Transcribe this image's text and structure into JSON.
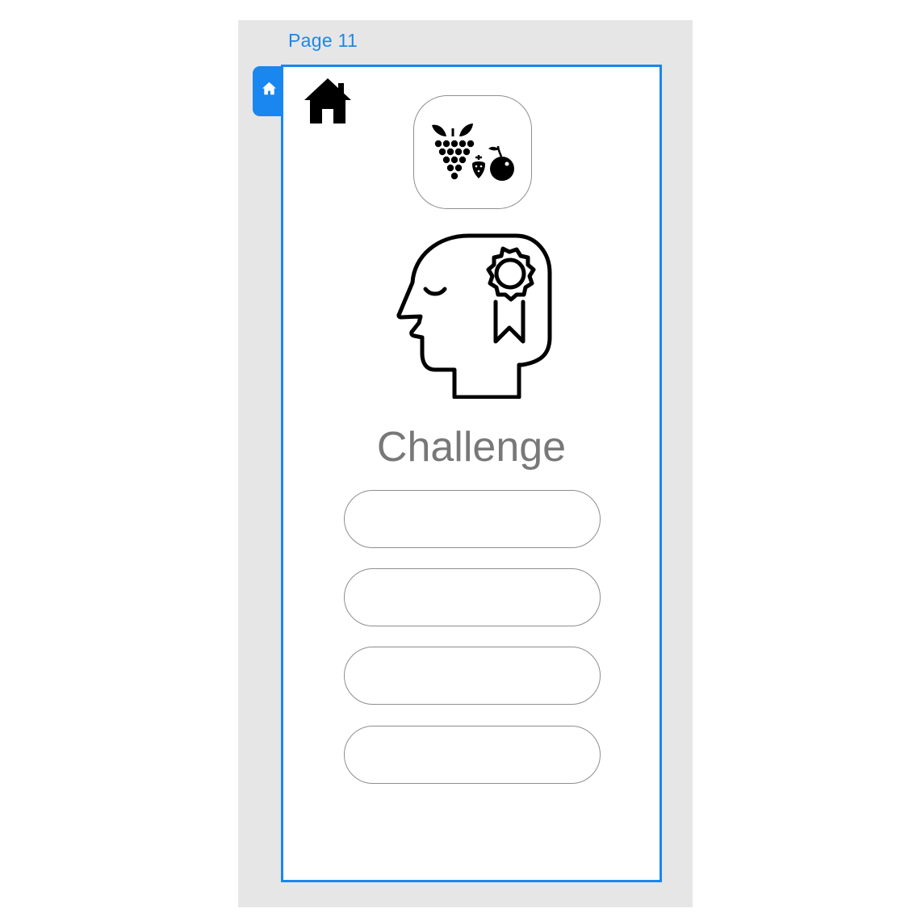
{
  "canvas": {
    "page_label": "Page 11",
    "accent_color": "#1a86f0",
    "background_color": "#e6e6e6"
  },
  "frame": {
    "home_tab_icon": "home-icon",
    "home_button_icon": "home-icon",
    "logo_icon": "fruit-logo-icon",
    "hero_icon": "head-award-icon",
    "title": "Challenge",
    "options": [
      {
        "label": ""
      },
      {
        "label": ""
      },
      {
        "label": ""
      },
      {
        "label": ""
      }
    ]
  }
}
